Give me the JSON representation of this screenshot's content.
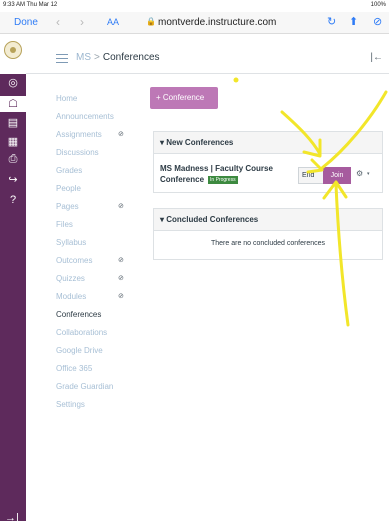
{
  "status": {
    "time": "9:33 AM  Thu Mar 12",
    "battery": "100%"
  },
  "safari": {
    "done": "Done",
    "back": "‹",
    "forward": "›",
    "text_size": "AA",
    "lock": "🔒",
    "url": "montverde.instructure.com",
    "reload": "↻",
    "share": "⬆",
    "compass": "⊘"
  },
  "global_nav": {
    "items": [
      {
        "name": "account",
        "glyph": "●"
      },
      {
        "name": "dashboard",
        "glyph": "◎"
      },
      {
        "name": "courses",
        "glyph": "☖"
      },
      {
        "name": "calendar",
        "glyph": "▤"
      },
      {
        "name": "inbox",
        "glyph": "▦"
      },
      {
        "name": "history",
        "glyph": "⎙"
      },
      {
        "name": "commons",
        "glyph": "↪"
      },
      {
        "name": "help",
        "glyph": "?"
      }
    ],
    "collapse": "→|"
  },
  "header": {
    "course": "MS",
    "separator": ">",
    "current": "Conferences",
    "collapse": "|←"
  },
  "course_nav": [
    {
      "label": "Home",
      "hidden": false
    },
    {
      "label": "Announcements",
      "hidden": false
    },
    {
      "label": "Assignments",
      "hidden": true
    },
    {
      "label": "Discussions",
      "hidden": false
    },
    {
      "label": "Grades",
      "hidden": false
    },
    {
      "label": "People",
      "hidden": false
    },
    {
      "label": "Pages",
      "hidden": true
    },
    {
      "label": "Files",
      "hidden": false
    },
    {
      "label": "Syllabus",
      "hidden": false
    },
    {
      "label": "Outcomes",
      "hidden": true
    },
    {
      "label": "Quizzes",
      "hidden": true
    },
    {
      "label": "Modules",
      "hidden": true
    },
    {
      "label": "Conferences",
      "hidden": false,
      "active": true
    },
    {
      "label": "Collaborations",
      "hidden": false
    },
    {
      "label": "Google Drive",
      "hidden": false
    },
    {
      "label": "Office 365",
      "hidden": false
    },
    {
      "label": "Grade Guardian",
      "hidden": false
    },
    {
      "label": "Settings",
      "hidden": false
    }
  ],
  "hidden_icon": "⊘",
  "main": {
    "new_button": "+ Conference",
    "new_conferences": {
      "heading": "▾ New Conferences",
      "title": "MS Madness | Faculty Course Conference",
      "status": "In Progress",
      "end_label": "End",
      "join_label": "Join",
      "settings_icon": "⚙",
      "caret": "▾"
    },
    "concluded": {
      "heading": "▾ Concluded Conferences",
      "empty": "There are no concluded conferences"
    }
  },
  "annotation_color": "#f2e62a"
}
